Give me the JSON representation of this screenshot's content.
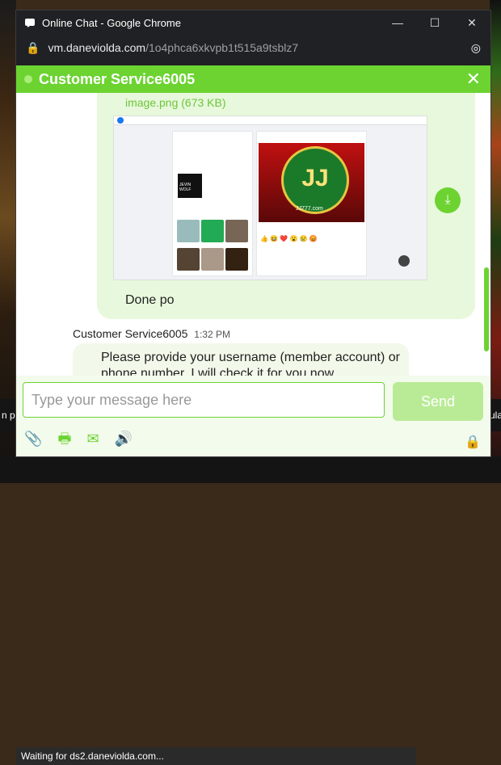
{
  "window": {
    "title": "Online Chat - Google Chrome",
    "url_host": "vm.daneviolda.com",
    "url_path": "/1o4phca6xkvpb1t515a9tsblz7",
    "status_text": "Waiting for ds2.daneviolda.com..."
  },
  "chat": {
    "agent_name": "Customer Service6005",
    "attachment_name": "image.png (673 KB)",
    "my_message": "Done po",
    "agent_message_sender": "Customer Service6005",
    "agent_message_time": "1:32 PM",
    "agent_message_text": "Please provide your username (member account) or phone number. I will check it for you now,",
    "input_placeholder": "Type your message here",
    "send_label": "Send"
  },
  "embedded_screenshot": {
    "photo_label": "JEVIN WOLF",
    "banner_text": "JJ",
    "banner_sub": "JJ777.com"
  },
  "background": {
    "left_strip": "n p",
    "right_strip": "ula"
  },
  "colors": {
    "accent": "#6cd331",
    "bubble_me": "#e8f8dc",
    "bubble_agent": "#f2f9ea",
    "send_button": "#b9eb97"
  },
  "icons": [
    "online-status-dot",
    "close-icon",
    "download-icon",
    "attach-icon",
    "print-icon",
    "email-icon",
    "sound-icon",
    "lock-icon",
    "eye-slash-icon"
  ]
}
